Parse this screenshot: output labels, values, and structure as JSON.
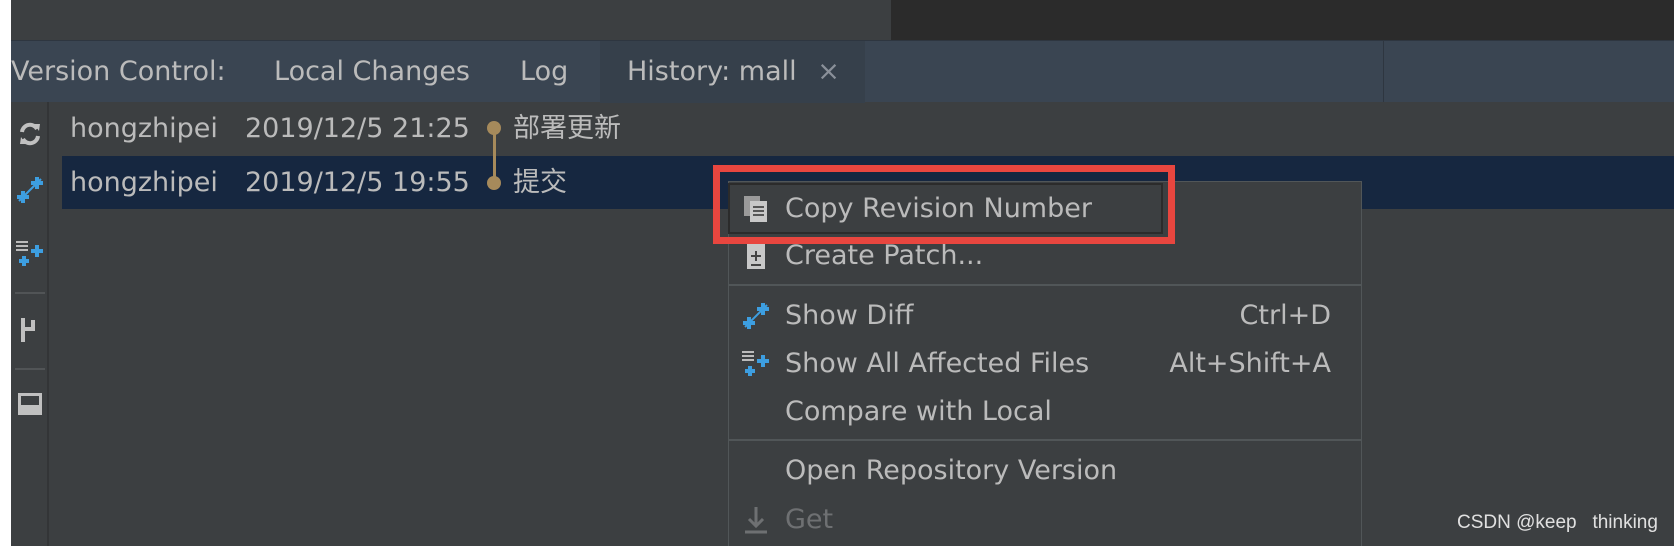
{
  "tabbar": {
    "label": "Version Control:",
    "tabs": [
      {
        "label": "Local Changes"
      },
      {
        "label": "Log"
      },
      {
        "label": "History: mall",
        "active": true,
        "close": "×"
      }
    ]
  },
  "toolbar": {
    "icons": [
      "refresh-icon",
      "show-diff-icon",
      "show-all-affected-icon",
      "branch-icon",
      "panel-icon"
    ]
  },
  "history": [
    {
      "author": "hongzhipei",
      "date": "2019/12/5 21:25",
      "message": "部署更新",
      "selected": false
    },
    {
      "author": "hongzhipei",
      "date": "2019/12/5 19:55",
      "message": "提交",
      "selected": true
    }
  ],
  "context_menu": {
    "items": [
      {
        "label": "Copy Revision Number",
        "icon": "copy-icon",
        "shortcut": "",
        "highlighted": true
      },
      {
        "label": "Create Patch...",
        "icon": "patch-icon",
        "shortcut": ""
      },
      {
        "label": "Show Diff",
        "icon": "diff-icon",
        "shortcut": "Ctrl+D"
      },
      {
        "label": "Show All Affected Files",
        "icon": "affected-files-icon",
        "shortcut": "Alt+Shift+A"
      },
      {
        "label": "Compare with Local",
        "icon": "",
        "shortcut": ""
      },
      {
        "label": "Open Repository Version",
        "icon": "",
        "shortcut": ""
      },
      {
        "label": "Get",
        "icon": "download-icon",
        "shortcut": "",
        "disabled": true
      }
    ]
  },
  "colors": {
    "accent_highlight": "#e8463f",
    "selection": "#162740",
    "graph": "#a68a5b",
    "diff_blue": "#3d9ee0"
  },
  "watermark": "CSDN @keep   thinking"
}
